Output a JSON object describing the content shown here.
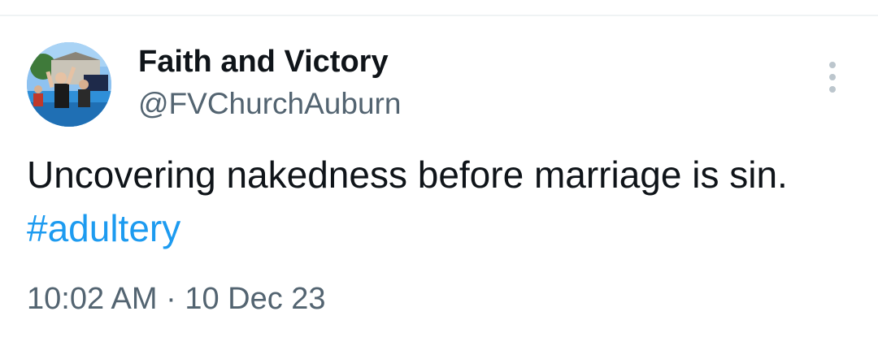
{
  "author": {
    "display_name": "Faith and Victory",
    "handle": "@FVChurchAuburn",
    "avatar_icon": "profile-photo-icon"
  },
  "menu": {
    "icon": "more-vertical-icon"
  },
  "tweet": {
    "text": "Uncovering nakedness before marriage is sin.",
    "hashtag": "#adultery"
  },
  "meta": {
    "time": "10:02 AM",
    "separator": "·",
    "date": "10 Dec 23"
  },
  "colors": {
    "text_primary": "#0f1419",
    "text_secondary": "#536471",
    "link": "#1d9bf0",
    "divider": "#eff3f4"
  }
}
